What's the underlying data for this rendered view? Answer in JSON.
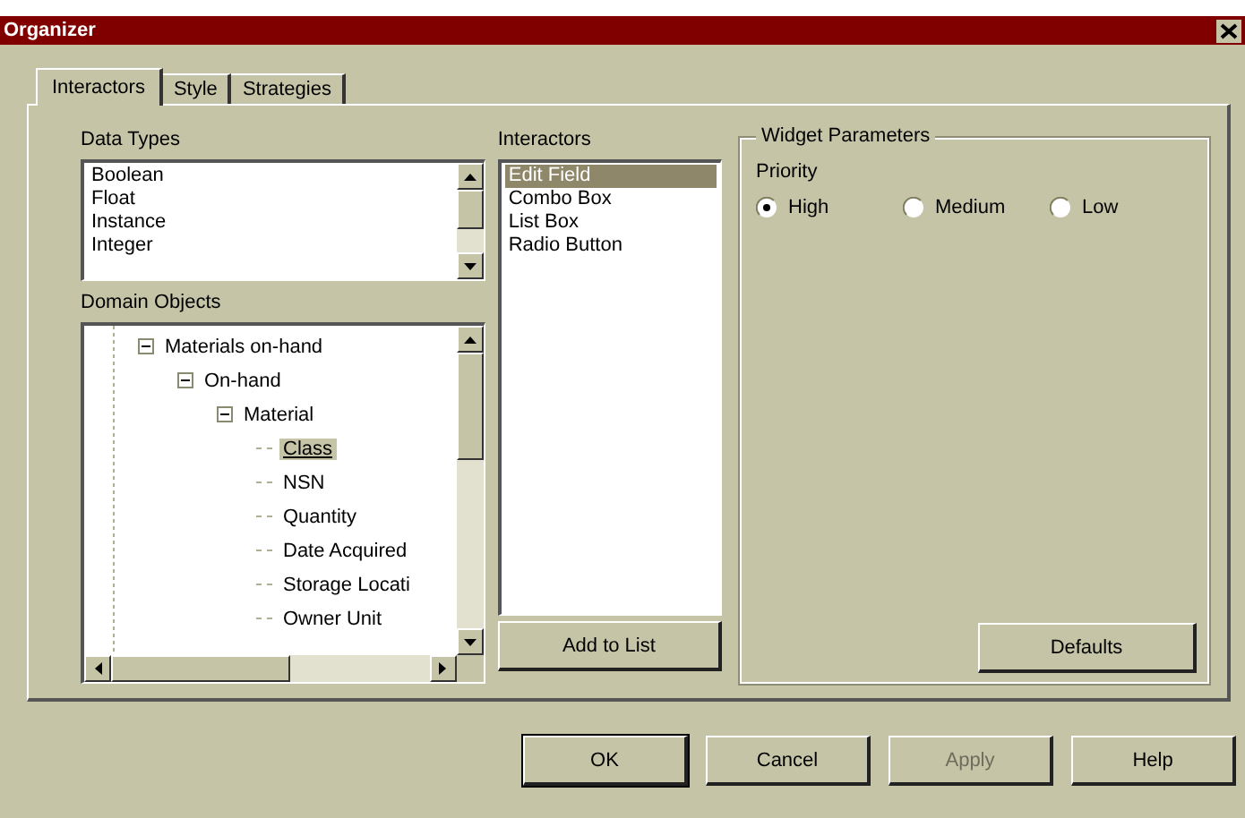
{
  "window": {
    "title": "Organizer"
  },
  "tabs": [
    {
      "label": "Interactors",
      "selected": true
    },
    {
      "label": "Style",
      "selected": false
    },
    {
      "label": "Strategies",
      "selected": false
    }
  ],
  "data_types": {
    "label": "Data Types",
    "items": [
      {
        "label": "Boolean",
        "selected": false
      },
      {
        "label": "Float",
        "selected": false
      },
      {
        "label": "Instance",
        "selected": false
      },
      {
        "label": "Integer",
        "selected": false
      }
    ]
  },
  "domain_objects": {
    "label": "Domain Objects",
    "tree": [
      {
        "label": "Materials on-hand",
        "expanded": true,
        "selected": false,
        "children": [
          {
            "label": "On-hand",
            "expanded": true,
            "selected": false,
            "children": [
              {
                "label": "Material",
                "expanded": true,
                "selected": false,
                "children": [
                  {
                    "label": "Class",
                    "selected": true
                  },
                  {
                    "label": "NSN",
                    "selected": false
                  },
                  {
                    "label": "Quantity",
                    "selected": false
                  },
                  {
                    "label": "Date Acquired",
                    "selected": false
                  },
                  {
                    "label": "Storage Locati",
                    "selected": false
                  },
                  {
                    "label": "Owner Unit",
                    "selected": false
                  }
                ]
              }
            ]
          }
        ]
      }
    ]
  },
  "interactors": {
    "label": "Interactors",
    "items": [
      {
        "label": "Edit Field",
        "selected": true
      },
      {
        "label": "Combo Box",
        "selected": false
      },
      {
        "label": "List Box",
        "selected": false
      },
      {
        "label": "Radio Button",
        "selected": false
      }
    ],
    "add_button": "Add to List"
  },
  "widget_parameters": {
    "title": "Widget Parameters",
    "priority_label": "Priority",
    "options": [
      {
        "label": "High",
        "selected": true
      },
      {
        "label": "Medium",
        "selected": false
      },
      {
        "label": "Low",
        "selected": false
      }
    ],
    "defaults_button": "Defaults"
  },
  "buttons": [
    {
      "label": "OK",
      "default": true,
      "disabled": false
    },
    {
      "label": "Cancel",
      "default": false,
      "disabled": false
    },
    {
      "label": "Apply",
      "default": false,
      "disabled": true
    },
    {
      "label": "Help",
      "default": false,
      "disabled": false
    }
  ]
}
